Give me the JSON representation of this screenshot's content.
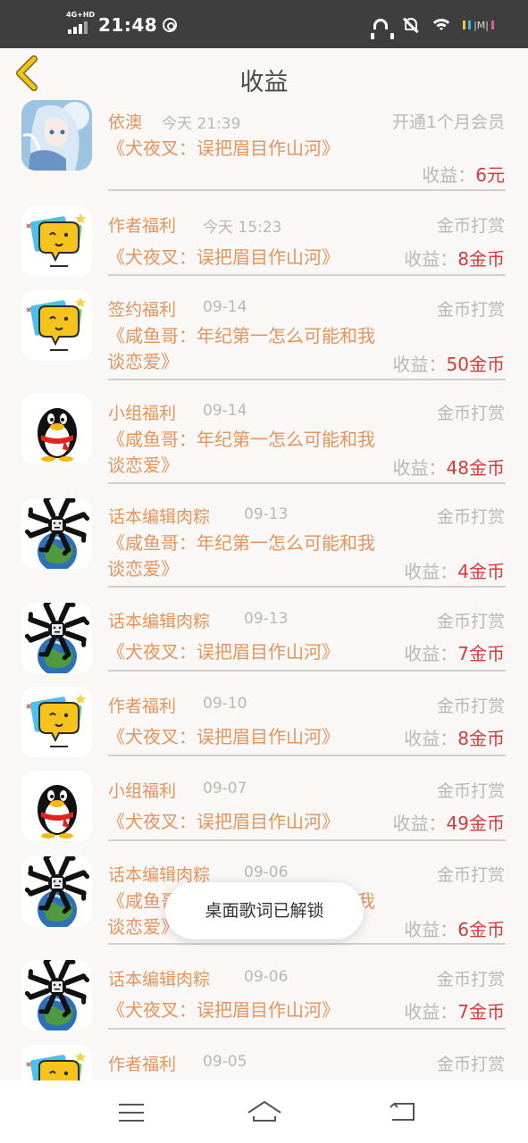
{
  "status_bar": {
    "network": "4G+HD",
    "time": "21:48",
    "battery_text": "|M|"
  },
  "header": {
    "title": "收益"
  },
  "toast": "桌面歌词已解锁",
  "earn_label": "收益：",
  "rows": [
    {
      "name": "依澳",
      "time": "今天 21:39",
      "type": "开通1个月会员",
      "book": "《犬夜叉：误把眉目作山河》",
      "value": "6元",
      "avatar": "anime-girl"
    },
    {
      "name": "作者福利",
      "time": "今天 15:23",
      "type": "金币打赏",
      "book": "《犬夜叉：误把眉目作山河》",
      "value": "8金币",
      "avatar": "chat-bubble"
    },
    {
      "name": "签约福利",
      "time": "09-14",
      "type": "金币打赏",
      "book": "《咸鱼哥：年纪第一怎么可能和我谈恋爱》",
      "value": "50金币",
      "avatar": "chat-bubble"
    },
    {
      "name": "小组福利",
      "time": "09-14",
      "type": "金币打赏",
      "book": "《咸鱼哥：年纪第一怎么可能和我谈恋爱》",
      "value": "48金币",
      "avatar": "penguin"
    },
    {
      "name": "话本编辑肉粽",
      "time": "09-13",
      "type": "金币打赏",
      "book": "《咸鱼哥：年纪第一怎么可能和我谈恋爱》",
      "value": "4金币",
      "avatar": "meme-earth"
    },
    {
      "name": "话本编辑肉粽",
      "time": "09-13",
      "type": "金币打赏",
      "book": "《犬夜叉：误把眉目作山河》",
      "value": "7金币",
      "avatar": "meme-earth"
    },
    {
      "name": "作者福利",
      "time": "09-10",
      "type": "金币打赏",
      "book": "《犬夜叉：误把眉目作山河》",
      "value": "8金币",
      "avatar": "chat-bubble"
    },
    {
      "name": "小组福利",
      "time": "09-07",
      "type": "金币打赏",
      "book": "《犬夜叉：误把眉目作山河》",
      "value": "49金币",
      "avatar": "penguin"
    },
    {
      "name": "话本编辑肉粽",
      "time": "09-06",
      "type": "金币打赏",
      "book": "《咸鱼哥：年纪第一怎么可能和我谈恋爱》",
      "value": "6金币",
      "avatar": "meme-earth"
    },
    {
      "name": "话本编辑肉粽",
      "time": "09-06",
      "type": "金币打赏",
      "book": "《犬夜叉：误把眉目作山河》",
      "value": "7金币",
      "avatar": "meme-earth"
    },
    {
      "name": "作者福利",
      "time": "09-05",
      "type": "金币打赏",
      "book": "",
      "value": "",
      "avatar": "chat-bubble"
    }
  ],
  "colors": {
    "accent_orange": "#e3955c",
    "value_red": "#d63a3a",
    "gray_text": "#b8b8b8",
    "back_arrow": "#f0c419"
  }
}
